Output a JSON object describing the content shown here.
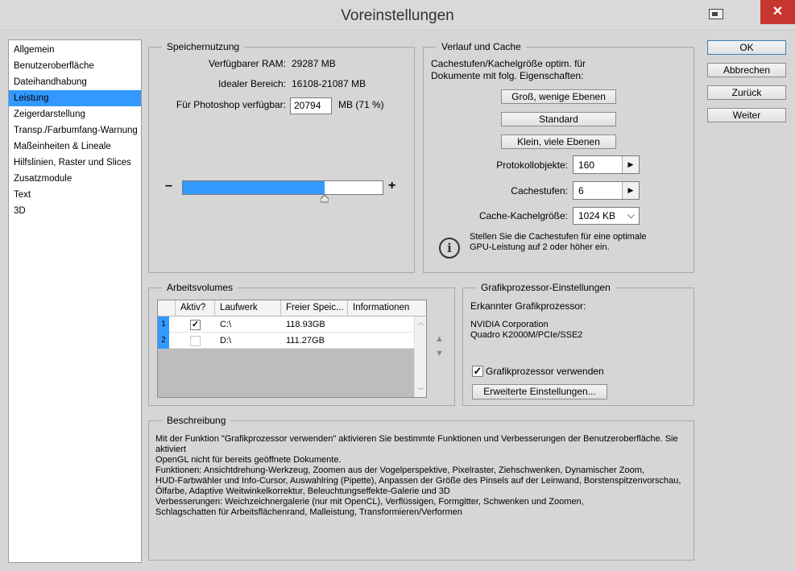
{
  "window": {
    "title": "Voreinstellungen",
    "close_glyph": "✕"
  },
  "nav": {
    "items": [
      "Allgemein",
      "Benutzeroberfläche",
      "Dateihandhabung",
      "Leistung",
      "Zeigerdarstellung",
      "Transp./Farbumfang-Warnung",
      "Maßeinheiten & Lineale",
      "Hilfslinien, Raster und Slices",
      "Zusatzmodule",
      "Text",
      "3D"
    ],
    "selected": "Leistung"
  },
  "speicher": {
    "title": "Speichernutzung",
    "ram_label": "Verfügbarer RAM:",
    "ram_value": "29287 MB",
    "ideal_label": "Idealer Bereich:",
    "ideal_value": "16108-21087 MB",
    "ps_label": "Für Photoshop verfügbar:",
    "ps_value": "20794",
    "ps_unit": "MB (71 %)",
    "minus": "–",
    "plus": "+",
    "slider_percent": 71
  },
  "cache": {
    "title": "Verlauf und Cache",
    "intro_line1": "Cachestufen/Kachelgröße optim. für",
    "intro_line2": "Dokumente mit folg. Eigenschaften:",
    "btn_big": "Groß, wenige Ebenen",
    "btn_default": "Standard",
    "btn_small": "Klein, viele Ebenen",
    "protokoll_label": "Protokollobjekte:",
    "protokoll_value": "160",
    "cachestufen_label": "Cachestufen:",
    "cachestufen_value": "6",
    "kachel_label": "Cache-Kachelgröße:",
    "kachel_value": "1024 KB",
    "info_line1": "Stellen Sie die Cachestufen für eine optimale",
    "info_line2": "GPU-Leistung auf 2 oder höher ein."
  },
  "volumes": {
    "title": "Arbeitsvolumes",
    "columns": [
      "Aktiv?",
      "Laufwerk",
      "Freier Speic...",
      "Informationen"
    ],
    "rows": [
      {
        "num": "1",
        "active": true,
        "drive": "C:\\",
        "free": "118.93GB",
        "info": ""
      },
      {
        "num": "2",
        "active": false,
        "drive": "D:\\",
        "free": "111.27GB",
        "info": ""
      }
    ]
  },
  "gpu": {
    "title": "Grafikprozessor-Einstellungen",
    "detected_label": "Erkannter Grafikprozessor:",
    "vendor": "NVIDIA Corporation",
    "model": "Quadro K2000M/PCIe/SSE2",
    "use_label": "Grafikprozessor verwenden",
    "use_checked": true,
    "advanced_btn": "Erweiterte Einstellungen..."
  },
  "buttons": {
    "ok": "OK",
    "cancel": "Abbrechen",
    "back": "Zurück",
    "next": "Weiter"
  },
  "beschreibung": {
    "title": "Beschreibung",
    "lines": [
      "Mit der Funktion \"Grafikprozessor verwenden\" aktivieren Sie bestimmte Funktionen und Verbesserungen der Benutzeroberfläche. Sie",
      "aktiviert",
      "OpenGL nicht für bereits geöffnete Dokumente.",
      "Funktionen: Ansichtdrehung-Werkzeug, Zoomen aus der Vogelperspektive, Pixelraster, Ziehschwenken, Dynamischer Zoom,",
      "HUD-Farbwähler und Info-Cursor, Auswahlring (Pipette), Anpassen der Größe des Pinsels auf der Leinwand, Borstenspitzenvorschau,",
      "Ölfarbe, Adaptive Weitwinkelkorrektur, Beleuchtungseffekte-Galerie und 3D",
      "Verbesserungen: Weichzeichnergalerie (nur mit OpenCL), Verflüssigen, Formgitter, Schwenken und Zoomen,",
      "Schlagschatten für Arbeitsflächenrand, Malleistung, Transformieren/Verformen"
    ]
  }
}
